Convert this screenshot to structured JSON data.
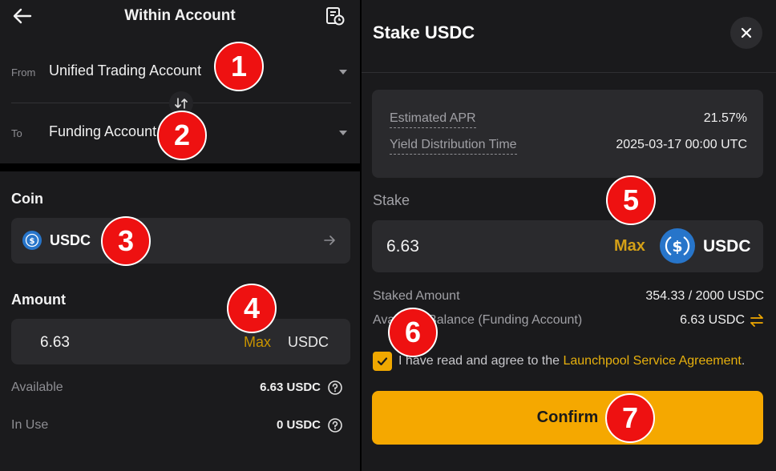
{
  "left_panel": {
    "title": "Within Account",
    "from_label": "From",
    "from_value": "Unified Trading Account",
    "to_label": "To",
    "to_value": "Funding Account",
    "coin_section_label": "Coin",
    "coin_value": "USDC",
    "amount_section_label": "Amount",
    "amount_value": "6.63",
    "max_label": "Max",
    "amount_unit": "USDC",
    "available_label": "Available",
    "available_value": "6.63 USDC",
    "in_use_label": "In Use",
    "in_use_value": "0 USDC"
  },
  "right_panel": {
    "title": "Stake USDC",
    "estimated_apr_label": "Estimated APR",
    "estimated_apr_value": "21.57%",
    "yield_time_label": "Yield Distribution Time",
    "yield_time_value": "2025-03-17 00:00 UTC",
    "stake_label": "Stake",
    "stake_value": "6.63",
    "max_label": "Max",
    "stake_unit": "USDC",
    "staked_amount_label": "Staked Amount",
    "staked_amount_value": "354.33 / 2000 USDC",
    "available_balance_label": "Available Balance (Funding Account)",
    "available_balance_value": "6.63 USDC",
    "agreement_text": "I have read and agree to the ",
    "agreement_link": "Launchpool Service Agreement",
    "agreement_period": ".",
    "confirm_label": "Confirm"
  },
  "markers": [
    "1",
    "2",
    "3",
    "4",
    "5",
    "6",
    "7"
  ],
  "colors": {
    "accent": "#F5A800",
    "marker": "#EE1111",
    "usdc": "#2775CA",
    "background": "#1B1B1D"
  },
  "icons": [
    "back-arrow-icon",
    "record-icon",
    "swap-icon",
    "usdc-icon",
    "arrow-right-icon",
    "help-icon",
    "close-icon",
    "check-icon",
    "transfer-icon",
    "chevron-down-icon"
  ]
}
